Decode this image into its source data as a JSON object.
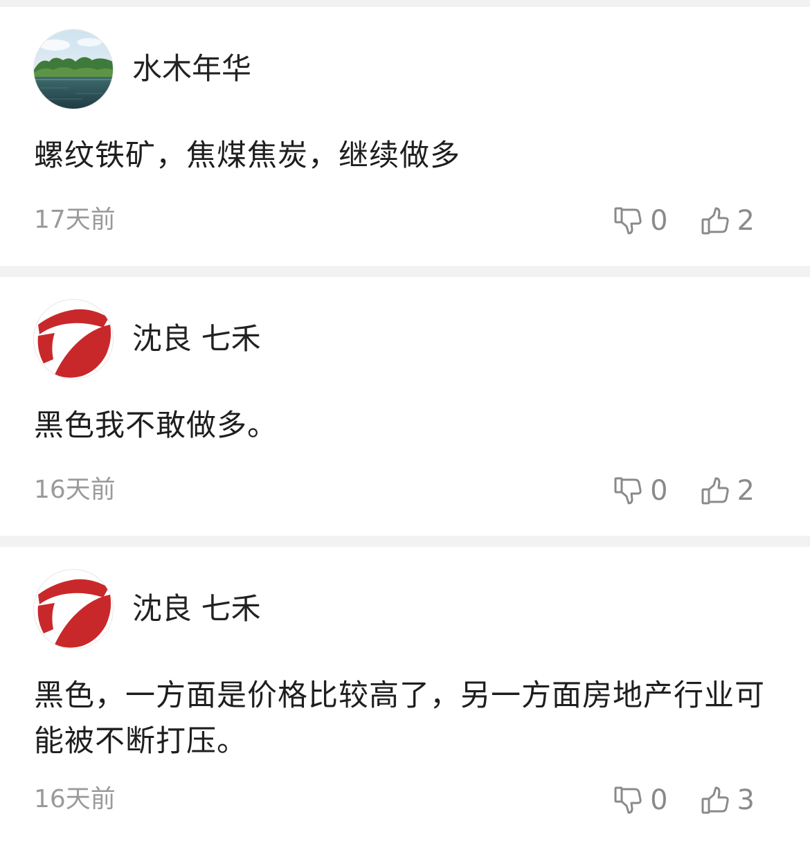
{
  "comments": [
    {
      "username": "水木年华",
      "avatar": "landscape-lake-photo",
      "text": "螺纹铁矿，焦煤焦炭，继续做多",
      "time": "17天前",
      "dislikes": "0",
      "likes": "2"
    },
    {
      "username": "沈良 七禾",
      "avatar": "qihe-logo-red",
      "text": "黑色我不敢做多。",
      "time": "16天前",
      "dislikes": "0",
      "likes": "2"
    },
    {
      "username": "沈良 七禾",
      "avatar": "qihe-logo-red",
      "text": "黑色，一方面是价格比较高了，另一方面房地产行业可能被不断打压。",
      "time": "16天前",
      "dislikes": "0",
      "likes": "3"
    }
  ],
  "icons": {
    "dislike": "thumbs-down-icon",
    "like": "thumbs-up-icon"
  },
  "colors": {
    "logo_red": "#c9282b",
    "meta_gray": "#9a9a9a",
    "separator": "#f2f2f2"
  }
}
